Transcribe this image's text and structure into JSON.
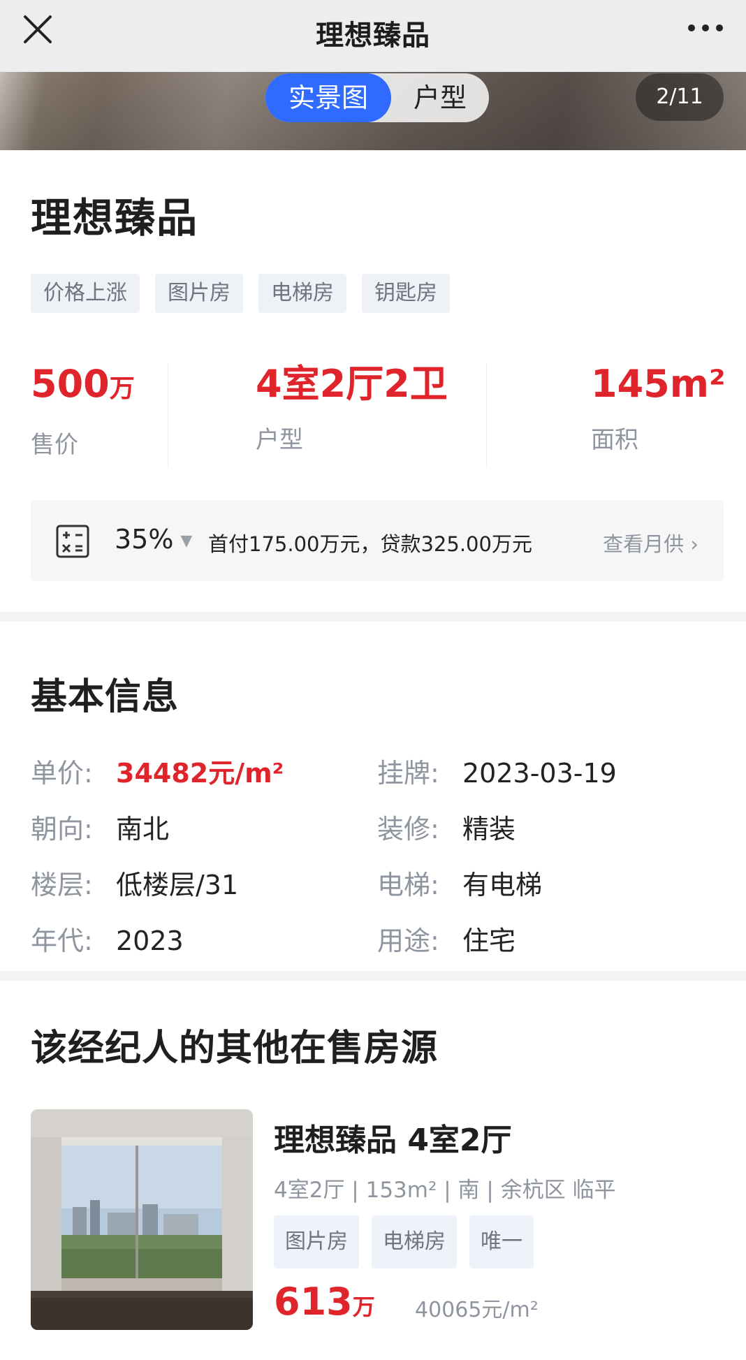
{
  "topbar": {
    "title": "理想臻品"
  },
  "gallery": {
    "tab_active": "实景图",
    "tab_other": "户型",
    "counter": "2/11"
  },
  "house": {
    "title": "理想臻品",
    "tags": [
      "价格上涨",
      "图片房",
      "电梯房",
      "钥匙房"
    ]
  },
  "stats": {
    "price_value": "500",
    "price_unit": "万",
    "price_label": "售价",
    "layout_value": "4室2厅2卫",
    "layout_label": "户型",
    "area_value": "145m²",
    "area_label": "面积"
  },
  "mortgage": {
    "ratio": "35%",
    "desc": "首付175.00万元，贷款325.00万元",
    "link": "查看月供 ›"
  },
  "basic_info": {
    "title": "基本信息",
    "rows": [
      {
        "label": "单价",
        "value": "34482元/m²"
      },
      {
        "label": "挂牌",
        "value": "2023-03-19"
      },
      {
        "label": "朝向",
        "value": "南北"
      },
      {
        "label": "装修",
        "value": "精装"
      },
      {
        "label": "楼层",
        "value": "低楼层/31"
      },
      {
        "label": "电梯",
        "value": "有电梯"
      },
      {
        "label": "年代",
        "value": "2023"
      },
      {
        "label": "用途",
        "value": "住宅"
      }
    ],
    "colon": ":"
  },
  "other_listings": {
    "title": "该经纪人的其他在售房源",
    "items": [
      {
        "title": "理想臻品 4室2厅",
        "meta": "4室2厅 | 153m² | 南 | 余杭区 临平",
        "tags": [
          "图片房",
          "电梯房",
          "唯一"
        ],
        "price": "613",
        "price_unit": "万",
        "unit_price": "40065元/m²"
      }
    ]
  }
}
